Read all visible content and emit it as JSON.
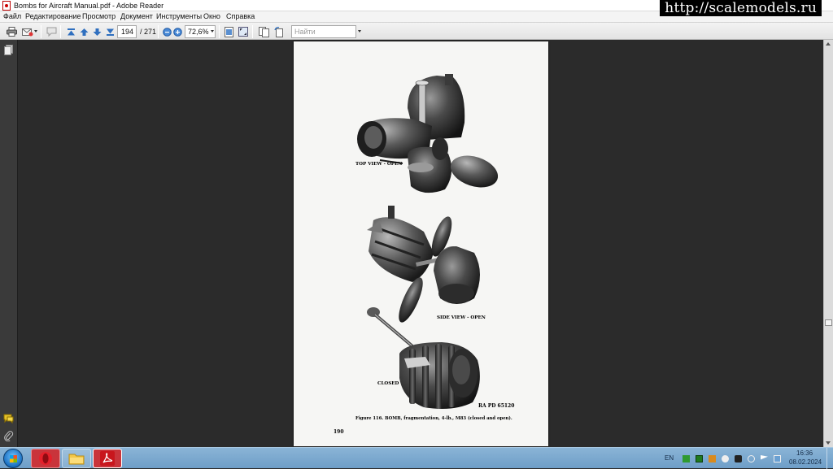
{
  "window": {
    "title": "Bombs for Aircraft Manual.pdf - Adobe Reader",
    "close_glyph": "x"
  },
  "watermark": "http://scalemodels.ru",
  "menu": [
    "Файл",
    "Редактирование",
    "Просмотр",
    "Документ",
    "Инструменты",
    "Окно",
    "Справка"
  ],
  "toolbar": {
    "page_current": "194",
    "page_total": "/ 271",
    "zoom": "72,6%",
    "search_placeholder": "Найти",
    "icons": [
      "print-icon",
      "email-icon",
      "comment-icon",
      "first-page-icon",
      "prev-page-icon",
      "next-page-icon",
      "last-page-icon",
      "zoom-out-icon",
      "zoom-in-icon",
      "fit-page-icon",
      "full-screen-icon",
      "two-page-icon",
      "rotate-icon"
    ]
  },
  "document": {
    "captions": {
      "top_view": "TOP VIEW - OPEN",
      "side_view": "SIDE VIEW - OPEN",
      "closed": "CLOSED",
      "ref": "RA PD 65120",
      "figure": "Figure 116. BOMB, fragmentation, 4-lb., M83 (closed and open).",
      "page_number": "190"
    }
  },
  "taskbar": {
    "apps": [
      "opera",
      "file-explorer",
      "adobe-reader"
    ],
    "language": "EN",
    "time": "16:36",
    "date": "08.02.2024"
  },
  "colors": {
    "workspace": "#2b2b2b",
    "page": "#f6f6f4",
    "taskbar": "#7aa7cf",
    "acrobat_red": "#c8161d"
  }
}
